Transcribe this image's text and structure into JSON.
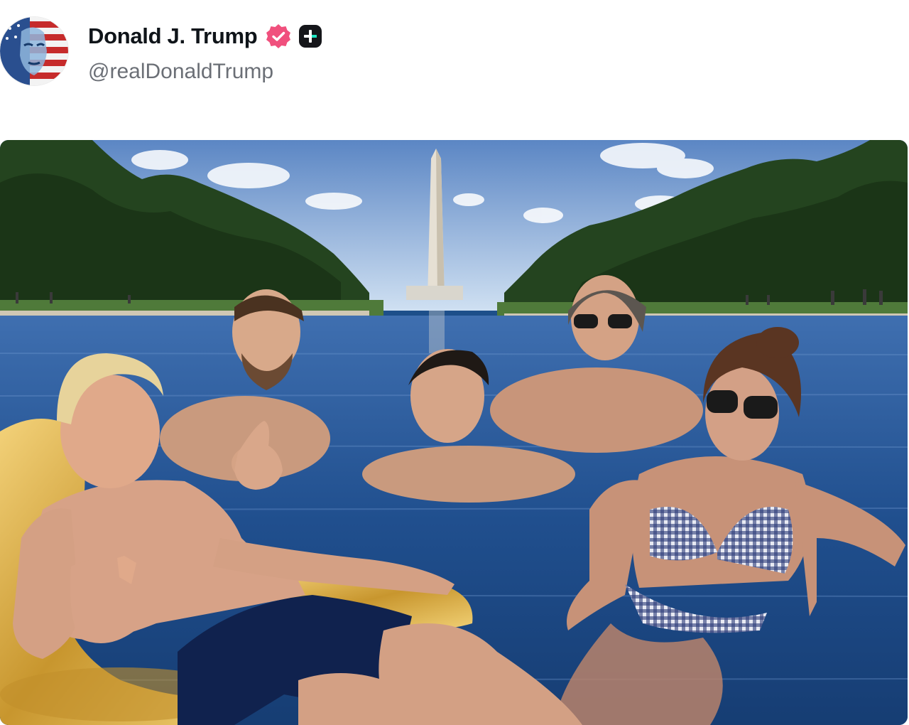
{
  "post": {
    "author": {
      "display_name": "Donald J. Trump",
      "handle": "@realDonaldTrump",
      "verified_badge": "verified-badge-icon",
      "extra_badge": "plus-badge-icon"
    },
    "media": {
      "type": "photo",
      "icon": "photo-image"
    }
  },
  "colors": {
    "verified_pink": "#f0507d",
    "badge_dark": "#15161a",
    "badge_accent": "#1de5c2",
    "handle_gray": "#6b6f76"
  }
}
